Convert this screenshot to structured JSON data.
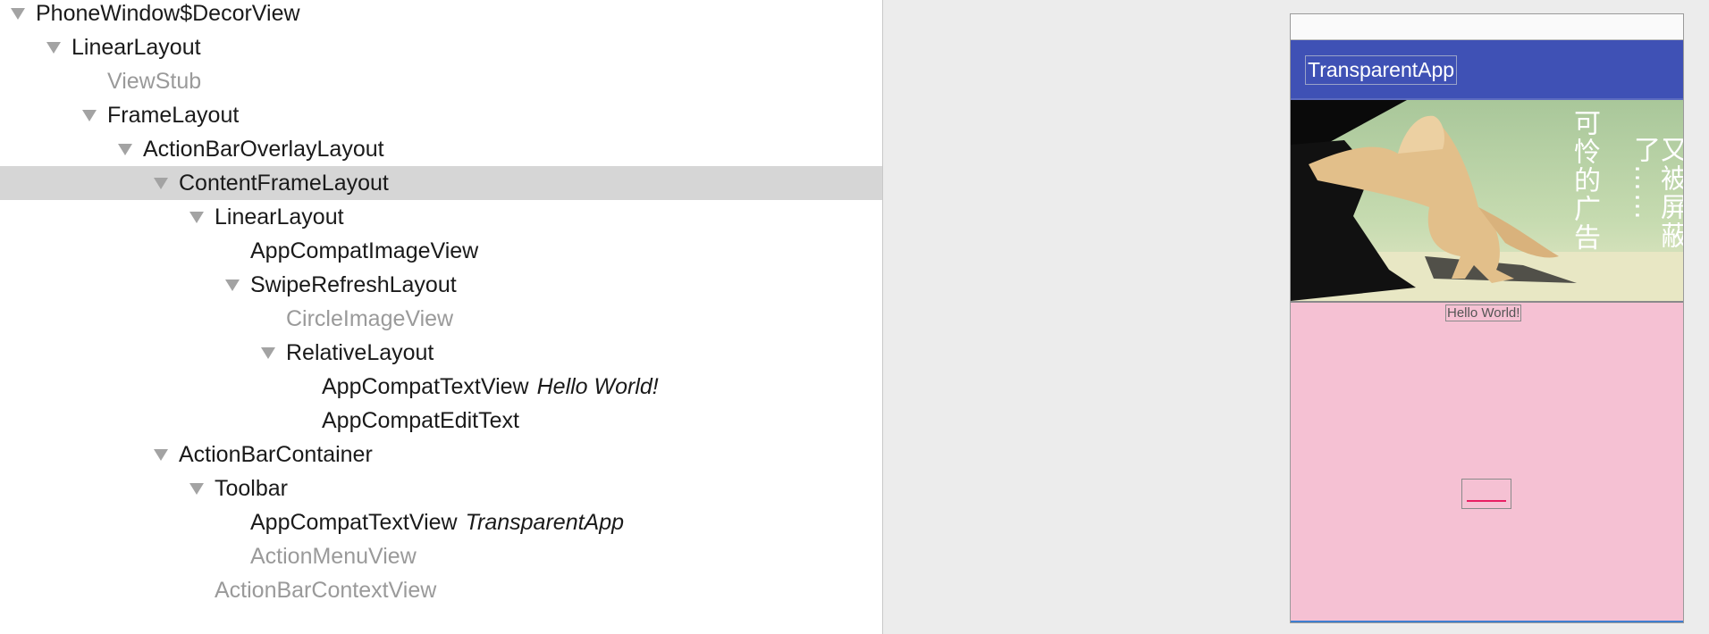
{
  "tree": {
    "nodes": [
      {
        "name": "PhoneWindow$DecorView",
        "text": "",
        "depth": 0,
        "expanded": true,
        "visible": true,
        "selected": false
      },
      {
        "name": "LinearLayout",
        "text": "",
        "depth": 1,
        "expanded": true,
        "visible": true,
        "selected": false
      },
      {
        "name": "ViewStub",
        "text": "",
        "depth": 2,
        "expanded": null,
        "visible": false,
        "selected": false
      },
      {
        "name": "FrameLayout",
        "text": "",
        "depth": 2,
        "expanded": true,
        "visible": true,
        "selected": false
      },
      {
        "name": "ActionBarOverlayLayout",
        "text": "",
        "depth": 3,
        "expanded": true,
        "visible": true,
        "selected": false
      },
      {
        "name": "ContentFrameLayout",
        "text": "",
        "depth": 4,
        "expanded": true,
        "visible": true,
        "selected": true
      },
      {
        "name": "LinearLayout",
        "text": "",
        "depth": 5,
        "expanded": true,
        "visible": true,
        "selected": false
      },
      {
        "name": "AppCompatImageView",
        "text": "",
        "depth": 6,
        "expanded": null,
        "visible": true,
        "selected": false
      },
      {
        "name": "SwipeRefreshLayout",
        "text": "",
        "depth": 6,
        "expanded": true,
        "visible": true,
        "selected": false
      },
      {
        "name": "CircleImageView",
        "text": "",
        "depth": 7,
        "expanded": null,
        "visible": false,
        "selected": false
      },
      {
        "name": "RelativeLayout",
        "text": "",
        "depth": 7,
        "expanded": true,
        "visible": true,
        "selected": false
      },
      {
        "name": "AppCompatTextView",
        "text": "Hello World!",
        "depth": 8,
        "expanded": null,
        "visible": true,
        "selected": false
      },
      {
        "name": "AppCompatEditText",
        "text": "",
        "depth": 8,
        "expanded": null,
        "visible": true,
        "selected": false
      },
      {
        "name": "ActionBarContainer",
        "text": "",
        "depth": 4,
        "expanded": true,
        "visible": true,
        "selected": false
      },
      {
        "name": "Toolbar",
        "text": "",
        "depth": 5,
        "expanded": true,
        "visible": true,
        "selected": false
      },
      {
        "name": "AppCompatTextView",
        "text": "TransparentApp",
        "depth": 6,
        "expanded": null,
        "visible": true,
        "selected": false
      },
      {
        "name": "ActionMenuView",
        "text": "",
        "depth": 6,
        "expanded": null,
        "visible": false,
        "selected": false
      },
      {
        "name": "ActionBarContextView",
        "text": "",
        "depth": 5,
        "expanded": null,
        "visible": false,
        "selected": false
      }
    ]
  },
  "preview": {
    "toolbar_title": "TransparentApp",
    "ad_line_1": "可怜的广告",
    "ad_line_2": "又被屏蔽了……",
    "hello_text": "Hello World!",
    "colors": {
      "toolbar": "#3f51b5",
      "content_background": "#f5c1d3",
      "edit_underline": "#e91e63",
      "selected_row": "#d6d6d6"
    }
  }
}
